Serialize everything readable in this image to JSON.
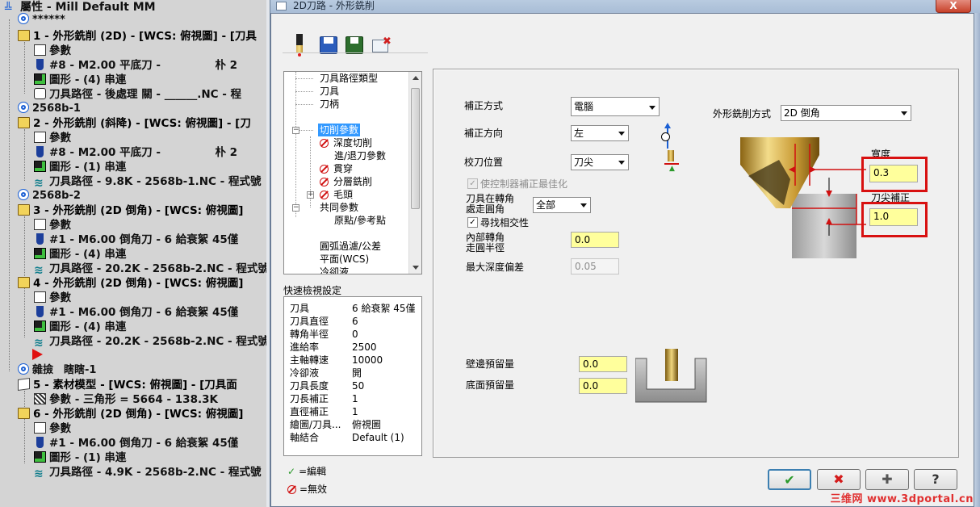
{
  "ops_tree": {
    "properties": "屬性 - Mill Default MM",
    "root_group": "******",
    "g1": "2568b-1",
    "g2": "2568b-2",
    "g3": "雜撿　瞎瞎-1",
    "op1": "1 - 外形銑削 (2D) - [WCS: 俯視圖] - [刀具",
    "op1_params": "參數",
    "op1_tool": "#8 - M2.00 平底刀 -　　　　　朴 2",
    "op1_geo": "圖形 - (4) 串連",
    "op1_path": "刀具路徑 - 後處理 關 - ______.NC - 程",
    "op2": "2 - 外形銑削 (斜降) - [WCS: 俯視圖] - [刀",
    "op2_params": "參數",
    "op2_tool": "#8 - M2.00 平底刀 -　　　　　朴 2",
    "op2_geo": "圖形 - (1) 串連",
    "op2_path": "刀具路徑 - 9.8K - 2568b-1.NC - 程式號",
    "op3": "3 - 外形銑削 (2D 倒角) - [WCS: 俯視圖]",
    "op3_params": "參數",
    "op3_tool": "#1 - M6.00 倒角刀 - 6 給衰絮 45僅",
    "op3_geo": "圖形 - (4) 串連",
    "op3_path": "刀具路徑 - 20.2K - 2568b-2.NC - 程式號",
    "op4": "4 - 外形銑削 (2D 倒角) - [WCS: 俯視圖]",
    "op4_params": "參數",
    "op4_tool": "#1 - M6.00 倒角刀 - 6 給衰絮 45僅",
    "op4_geo": "圖形 - (4) 串連",
    "op4_path": "刀具路徑 - 20.2K - 2568b-2.NC - 程式號",
    "op5": "5 - 素材模型 - [WCS: 俯視圖] - [刀具面",
    "op5_params": "參數 - 三角形 = 5664 - 138.3K",
    "op6": "6 - 外形銑削 (2D 倒角) - [WCS: 俯視圖]",
    "op6_params": "參數",
    "op6_tool": "#1 - M6.00 倒角刀 - 6 給衰絮 45僅",
    "op6_geo": "圖形 - (1) 串連",
    "op6_path": "刀具路徑 - 4.9K - 2568b-2.NC - 程式號"
  },
  "window": {
    "title": "2D刀路 - 外形銑削",
    "close": "X"
  },
  "param_tree": {
    "items": [
      "刀具路徑類型",
      "刀具",
      "刀柄",
      "切削參數",
      "深度切削",
      "進/退刀參數",
      "貫穿",
      "分層銑削",
      "毛頭",
      "共同參數",
      "原點/參考點",
      "圓弧過濾/公差",
      "平面(WCS)",
      "冷卻液"
    ]
  },
  "quick_view": {
    "label": "快速檢視設定",
    "rows": [
      {
        "k": "刀具",
        "v": "6 給衰絮 45僅"
      },
      {
        "k": "刀具直徑",
        "v": "6"
      },
      {
        "k": "轉角半徑",
        "v": "0"
      },
      {
        "k": "進給率",
        "v": "2500"
      },
      {
        "k": "主軸轉速",
        "v": "10000"
      },
      {
        "k": "冷卻液",
        "v": "開"
      },
      {
        "k": "刀具長度",
        "v": "50"
      },
      {
        "k": "刀長補正",
        "v": "1"
      },
      {
        "k": "直徑補正",
        "v": "1"
      },
      {
        "k": "繪圖/刀具...",
        "v": "俯視圖"
      },
      {
        "k": "軸結合",
        "v": "Default (1)"
      }
    ]
  },
  "legend": {
    "edited": "=編輯",
    "disabled": "=無效"
  },
  "form": {
    "comp_type_label": "補正方式",
    "comp_type_value": "電腦",
    "comp_dir_label": "補正方向",
    "comp_dir_value": "左",
    "tip_comp_label": "校刀位置",
    "tip_comp_value": "刀尖",
    "optimize_label": "使控制器補正最佳化",
    "roll_label_1": "刀具在轉角",
    "roll_label_2": "處走圓角",
    "roll_value": "全部",
    "find_intersect_label": "尋找相交性",
    "inner_radius_label_1": "內部轉角",
    "inner_radius_label_2": "走圓半徑",
    "inner_radius_value": "0.0",
    "max_depth_label": "最大深度偏差",
    "max_depth_value": "0.05",
    "contour_type_label": "外形銑削方式",
    "contour_type_value": "2D 倒角",
    "width_label": "寬度",
    "width_value": "0.3",
    "tip_offset_label": "刀尖補正",
    "tip_offset_value": "1.0",
    "wall_stock_label": "壁邊預留量",
    "wall_stock_value": "0.0",
    "floor_stock_label": "底面預留量",
    "floor_stock_value": "0.0"
  },
  "watermark": "三维网 www.3dportal.cn",
  "colors": {
    "highlight": "#d81010",
    "input_yellow": "#ffff9c",
    "selection": "#3399ff"
  }
}
